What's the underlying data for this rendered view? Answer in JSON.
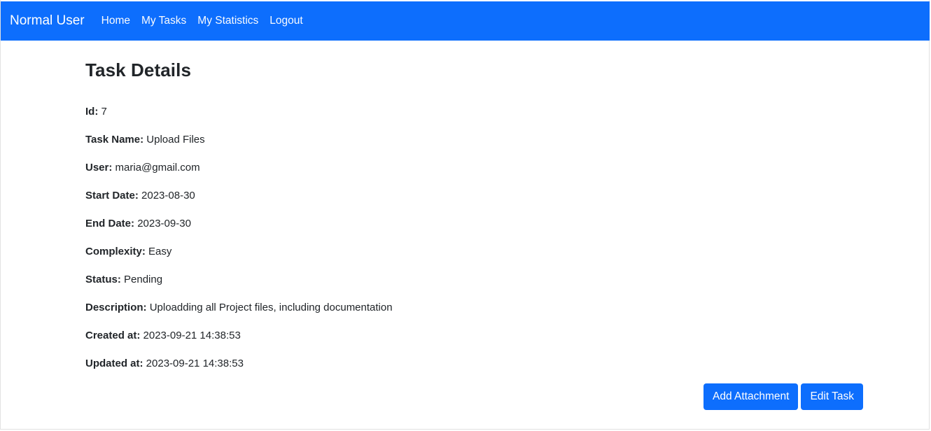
{
  "navbar": {
    "brand": "Normal User",
    "links": [
      {
        "label": "Home"
      },
      {
        "label": "My Tasks"
      },
      {
        "label": "My Statistics"
      },
      {
        "label": "Logout"
      }
    ]
  },
  "page": {
    "title": "Task Details"
  },
  "task": {
    "fields": [
      {
        "label": "Id:",
        "value": "7"
      },
      {
        "label": "Task Name:",
        "value": "Upload Files"
      },
      {
        "label": "User:",
        "value": "maria@gmail.com"
      },
      {
        "label": "Start Date:",
        "value": "2023-08-30"
      },
      {
        "label": "End Date:",
        "value": "2023-09-30"
      },
      {
        "label": "Complexity:",
        "value": "Easy"
      },
      {
        "label": "Status:",
        "value": "Pending"
      },
      {
        "label": "Description:",
        "value": "Uploadding all Project files, including documentation"
      },
      {
        "label": "Created at:",
        "value": "2023-09-21 14:38:53"
      },
      {
        "label": "Updated at:",
        "value": "2023-09-21 14:38:53"
      }
    ]
  },
  "actions": {
    "add_attachment_label": "Add Attachment",
    "edit_task_label": "Edit Task"
  },
  "colors": {
    "primary": "#0d6efd",
    "text": "#212529",
    "background": "#ffffff"
  }
}
